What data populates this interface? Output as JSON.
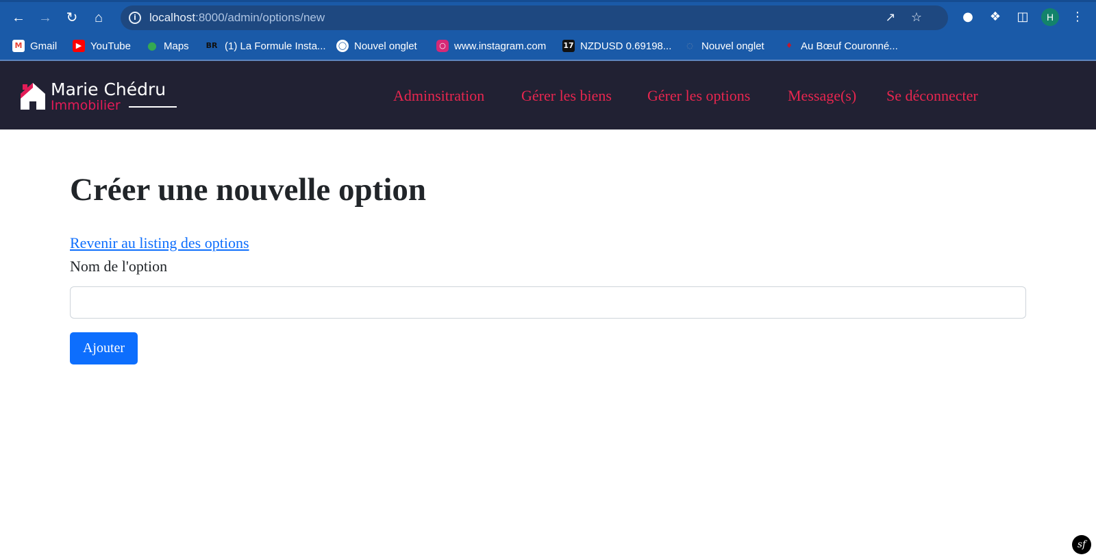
{
  "browser": {
    "url_host": "localhost",
    "url_path": ":8000/admin/options/new",
    "profile_initial": "H",
    "bookmarks": [
      {
        "label": "Gmail",
        "icon": "gmail-icon"
      },
      {
        "label": "YouTube",
        "icon": "youtube-icon"
      },
      {
        "label": "Maps",
        "icon": "maps-icon"
      },
      {
        "label": "(1) La Formule Insta...",
        "icon": "br-icon",
        "icon_text": "BR"
      },
      {
        "label": "Nouvel onglet",
        "icon": "globe-icon"
      },
      {
        "label": "www.instagram.com",
        "icon": "instagram-icon"
      },
      {
        "label": "NZDUSD 0.69198...",
        "icon": "tradingview-icon",
        "icon_text": "17"
      },
      {
        "label": "Nouvel onglet",
        "icon": "page-icon"
      },
      {
        "label": "Au Bœuf Couronné...",
        "icon": "restaurant-icon"
      }
    ]
  },
  "site": {
    "brand_name": "Marie Chédru",
    "brand_sub": "Immobilier",
    "menu": [
      "Adminsitration",
      "Gérer les biens",
      "Gérer les options",
      "Message(s)",
      "Se déconnecter"
    ]
  },
  "main": {
    "title": "Créer une nouvelle option",
    "back_link": "Revenir au listing des options",
    "field_label": "Nom de l'option",
    "field_value": "",
    "submit_label": "Ajouter"
  },
  "footer": {
    "symfony_badge": "sf"
  },
  "colors": {
    "browser_bar": "#1a5aa8",
    "site_header": "#212133",
    "accent": "#e8264f",
    "primary_button": "#0d6efd"
  }
}
